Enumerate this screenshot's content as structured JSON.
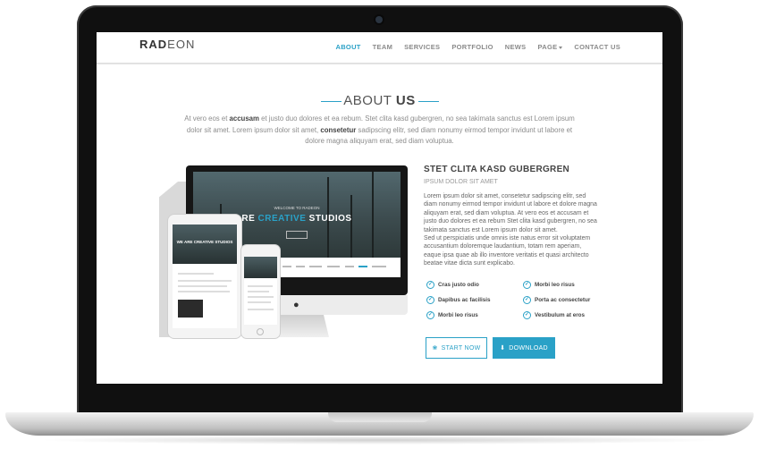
{
  "navbar": {
    "logo_bold": "RAD",
    "logo_light": "EON",
    "items": [
      {
        "label": "ABOUT",
        "active": true
      },
      {
        "label": "TEAM",
        "active": false
      },
      {
        "label": "SERVICES",
        "active": false
      },
      {
        "label": "PORTFOLIO",
        "active": false
      },
      {
        "label": "NEWS",
        "active": false
      },
      {
        "label": "PAGE",
        "active": false,
        "dropdown": true
      },
      {
        "label": "CONTACT US",
        "active": false
      }
    ]
  },
  "about": {
    "title_light": "ABOUT",
    "title_bold": "US",
    "intro": {
      "p1": "At vero eos et ",
      "b1": "accusam",
      "p2": " et justo duo dolores et ea rebum. Stet clita kasd gubergren, no sea takimata sanctus est Lorem ipsum dolor sit amet. Lorem ipsum dolor sit amet, ",
      "b2": "consetetur",
      "p3": " sadipscing elitr, sed diam nonumy eirmod tempor invidunt ut labore et dolore magna aliquyam erat, sed diam voluptua."
    }
  },
  "mockup": {
    "hero_small": "WELCOME TO RADEON",
    "hero_prefix": "RE ",
    "hero_accent": "CREATIVE",
    "hero_suffix": " STUDIOS",
    "tablet_hero": "WE ARE CREATIVE STUDIOS"
  },
  "feature": {
    "title": "STET CLITA KASD GUBERGREN",
    "subtitle": "IPSUM DOLOR SIT AMET",
    "para1": "Lorem ipsum dolor sit amet, consetetur sadipscing elitr, sed diam nonumy eirmod tempor invidunt ut labore et dolore magna aliquyam erat, sed diam voluptua. At vero eos et accusam et justo duo dolores et ea rebum Stet clita kasd gubergren, no sea takimata sanctus est Lorem ipsum dolor sit amet.",
    "para2": "Sed ut perspiciatis unde omnis iste natus error sit voluptatem accusantium doloremque laudantium, totam rem aperiam, eaque ipsa quae ab illo inventore veritatis et quasi architecto beatae vitae dicta sunt explicabo.",
    "checks": [
      "Cras justo odio",
      "Morbi leo risus",
      "Dapibus ac facilisis",
      "Porta ac consectetur",
      "Morbi leo risus",
      "Vestibulum at eros"
    ]
  },
  "buttons": {
    "start": "START NOW",
    "download": "DOWNLOAD"
  },
  "colors": {
    "accent": "#2aa1c7",
    "text_dark": "#444444",
    "text_muted": "#8c8c8c",
    "laptop_bezel": "#101010"
  },
  "icons": {
    "start": "leaf-icon",
    "download": "download-icon",
    "check": "check-circle-icon",
    "logo": "apple-icon"
  }
}
